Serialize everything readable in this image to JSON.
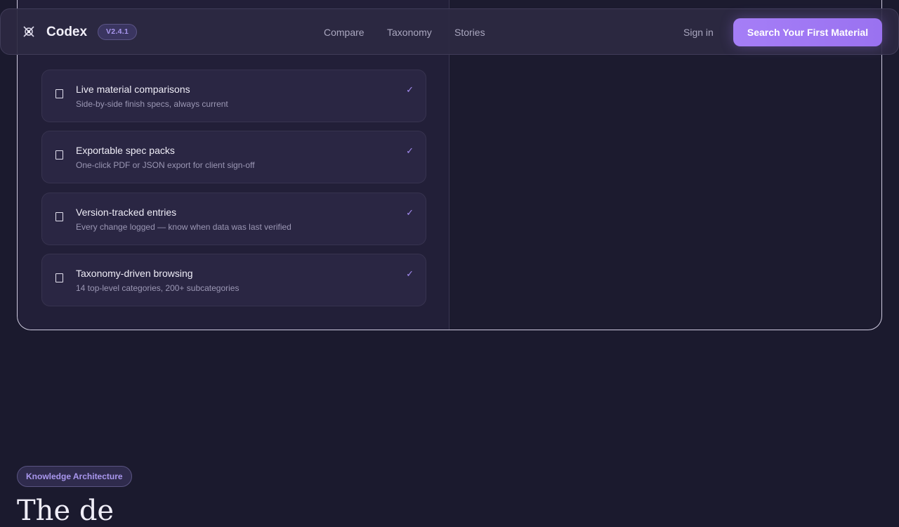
{
  "nav": {
    "brand": "Codex",
    "version": "V2.4.1",
    "links": [
      "Compare",
      "Taxonomy",
      "Stories"
    ],
    "sign_in": "Sign in",
    "cta": "Search Your First Material"
  },
  "features": [
    {
      "title": "Live material comparisons",
      "subtitle": "Side-by-side finish specs, always current",
      "icon": "square-icon",
      "check": "✓"
    },
    {
      "title": "Exportable spec packs",
      "subtitle": "One-click PDF or JSON export for client sign-off",
      "icon": "square-icon",
      "check": "✓"
    },
    {
      "title": "Version-tracked entries",
      "subtitle": "Every change logged — know when data was last verified",
      "icon": "square-icon",
      "check": "✓"
    },
    {
      "title": "Taxonomy-driven browsing",
      "subtitle": "14 top-level categories, 200+ subcategories",
      "icon": "square-icon",
      "check": "✓"
    }
  ],
  "section": {
    "badge": "Knowledge Architecture",
    "heading": "The de"
  },
  "colors": {
    "background": "#1b1a2e",
    "accent": "#a57ef7",
    "card": "#2a2643"
  }
}
